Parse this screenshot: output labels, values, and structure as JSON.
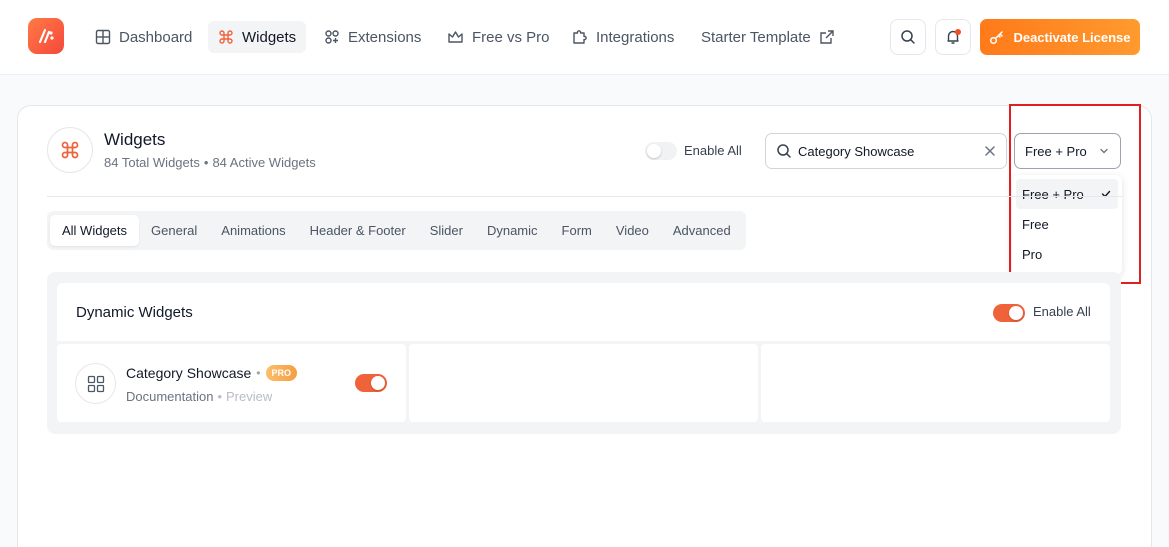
{
  "nav": {
    "items": [
      {
        "label": "Dashboard",
        "icon": "grid-icon"
      },
      {
        "label": "Widgets",
        "icon": "command-icon"
      },
      {
        "label": "Extensions",
        "icon": "extensions-icon"
      },
      {
        "label": "Free vs Pro",
        "icon": "crown-icon"
      },
      {
        "label": "Integrations",
        "icon": "puzzle-icon"
      },
      {
        "label": "Starter Template",
        "icon": "external-link-icon"
      }
    ],
    "active": "Widgets",
    "cta_label": "Deactivate License"
  },
  "header": {
    "title": "Widgets",
    "total": "84 Total Widgets",
    "separator": "•",
    "active": "84 Active Widgets",
    "enable_all_label": "Enable All",
    "enable_all_on": false
  },
  "search": {
    "value": "Category Showcase"
  },
  "filter": {
    "selected": "Free + Pro",
    "options": [
      "Free + Pro",
      "Free",
      "Pro"
    ]
  },
  "tabs": [
    "All Widgets",
    "General",
    "Animations",
    "Header & Footer",
    "Slider",
    "Dynamic",
    "Form",
    "Video",
    "Advanced"
  ],
  "section": {
    "title": "Dynamic Widgets",
    "enable_all_label": "Enable All",
    "enable_all_on": true,
    "widgets": [
      {
        "name": "Category Showcase",
        "separator": "•",
        "badge": "PRO",
        "doc_label": "Documentation",
        "preview_label": "Preview",
        "enabled": true
      }
    ]
  },
  "colors": {
    "accent": "#f0623a",
    "cta": "#ff8a24",
    "highlight": "#e02020"
  }
}
